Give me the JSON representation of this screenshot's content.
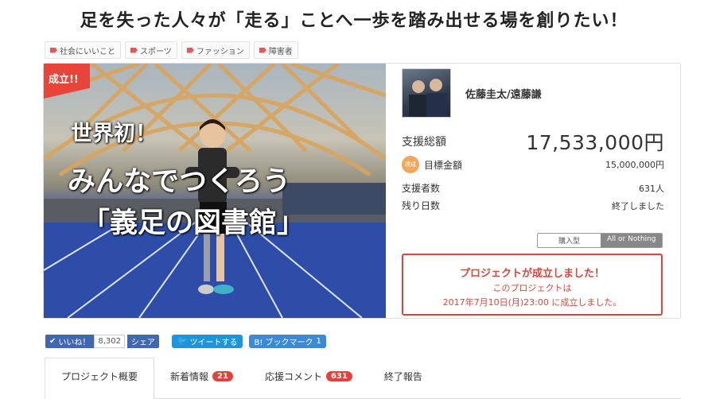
{
  "page": {
    "title": "足を失った人々が「走る」ことへ一歩を踏み出せる場を創りたい！"
  },
  "tags": [
    "社会にいいこと",
    "スポーツ",
    "ファッション",
    "障害者"
  ],
  "hero": {
    "ribbon": "成立!!",
    "line1": "世界初！",
    "line2": "みんなでつくろう",
    "line3": "「義足の図書館」"
  },
  "owner": {
    "name": "佐藤圭太/遠藤謙"
  },
  "stats": {
    "total_label": "支援総額",
    "total_value": "17,533,000円",
    "achieved_badge": "達成",
    "goal_label": "目標金額",
    "goal_value": "15,000,000円",
    "backers_label": "支援者数",
    "backers_value": "631人",
    "days_label": "残り日数",
    "days_value": "終了しました"
  },
  "funding_type": {
    "option1": "購入型",
    "option2": "All or Nothing",
    "selected": "All or Nothing"
  },
  "success": {
    "title": "プロジェクトが成立しました！",
    "line1": "このプロジェクトは",
    "line2": "2017年7月10日(月)23:00 に成立しました。"
  },
  "share": {
    "fb_like": "いいね！",
    "fb_count": "8,302",
    "fb_share": "シェア",
    "tweet": "ツイートする",
    "hatena": "B! ブックマーク",
    "hatena_count": "1"
  },
  "tabs": [
    {
      "label": "プロジェクト概要",
      "count": ""
    },
    {
      "label": "新着情報",
      "count": "21"
    },
    {
      "label": "応援コメント",
      "count": "631"
    },
    {
      "label": "終了報告",
      "count": ""
    }
  ],
  "colors": {
    "accent": "#e1433b",
    "facebook": "#4267b2",
    "twitter": "#1b95e0"
  }
}
